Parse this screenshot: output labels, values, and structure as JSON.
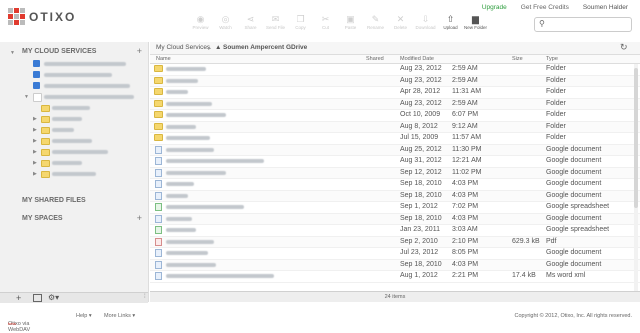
{
  "app": {
    "logo_text": "OTIXO"
  },
  "toolbar": [
    {
      "label": "Preview",
      "icon": "eye-icon",
      "enabled": false
    },
    {
      "label": "Watch",
      "icon": "watch-icon",
      "enabled": false
    },
    {
      "label": "Share",
      "icon": "share-icon",
      "enabled": false
    },
    {
      "label": "Send File",
      "icon": "send-icon",
      "enabled": false
    },
    {
      "label": "Copy",
      "icon": "copy-icon",
      "enabled": false
    },
    {
      "label": "Cut",
      "icon": "cut-icon",
      "enabled": false
    },
    {
      "label": "Paste",
      "icon": "paste-icon",
      "enabled": false
    },
    {
      "label": "Rename",
      "icon": "pencil-icon",
      "enabled": false
    },
    {
      "label": "Delete",
      "icon": "delete-icon",
      "enabled": false
    },
    {
      "label": "Download",
      "icon": "download-icon",
      "enabled": false
    },
    {
      "label": "Upload",
      "icon": "upload-icon",
      "enabled": true
    },
    {
      "label": "New Folder",
      "icon": "new-folder-icon",
      "enabled": true
    }
  ],
  "top_links": {
    "upgrade": "Upgrade",
    "credits": "Get Free Credits",
    "user": "Soumen Halder"
  },
  "search": {
    "placeholder": ""
  },
  "sidebar": {
    "cloud_title": "MY CLOUD SERVICES",
    "shared_title": "MY SHARED FILES",
    "spaces_title": "MY SPACES"
  },
  "breadcrumb": {
    "root": "My Cloud Services",
    "current": "Soumen Ampercent GDrive"
  },
  "columns": {
    "name": "Name",
    "shared": "Shared",
    "modified": "Modified Date",
    "size": "Size",
    "type": "Type"
  },
  "files": [
    {
      "kind": "folder",
      "date": "Aug 23, 2012",
      "time": "2:59 AM",
      "size": "",
      "type": "Folder"
    },
    {
      "kind": "folder",
      "date": "Aug 23, 2012",
      "time": "2:59 AM",
      "size": "",
      "type": "Folder"
    },
    {
      "kind": "folder",
      "date": "Apr 28, 2012",
      "time": "11:31 AM",
      "size": "",
      "type": "Folder"
    },
    {
      "kind": "folder",
      "date": "Aug 23, 2012",
      "time": "2:59 AM",
      "size": "",
      "type": "Folder"
    },
    {
      "kind": "folder",
      "date": "Oct 10, 2009",
      "time": "6:07 PM",
      "size": "",
      "type": "Folder"
    },
    {
      "kind": "folder",
      "date": "Aug 8, 2012",
      "time": "9:12 AM",
      "size": "",
      "type": "Folder"
    },
    {
      "kind": "folder",
      "date": "Jul 15, 2009",
      "time": "11:57 AM",
      "size": "",
      "type": "Folder"
    },
    {
      "kind": "doc",
      "date": "Aug 25, 2012",
      "time": "11:30 PM",
      "size": "",
      "type": "Google document"
    },
    {
      "kind": "doc",
      "date": "Aug 31, 2012",
      "time": "12:21 AM",
      "size": "",
      "type": "Google document"
    },
    {
      "kind": "doc",
      "date": "Sep 12, 2012",
      "time": "11:02 PM",
      "size": "",
      "type": "Google document"
    },
    {
      "kind": "doc",
      "date": "Sep 18, 2010",
      "time": "4:03 PM",
      "size": "",
      "type": "Google document"
    },
    {
      "kind": "doc",
      "date": "Sep 18, 2010",
      "time": "4:03 PM",
      "size": "",
      "type": "Google document"
    },
    {
      "kind": "xls",
      "date": "Sep 1, 2012",
      "time": "7:02 PM",
      "size": "",
      "type": "Google spreadsheet"
    },
    {
      "kind": "doc",
      "date": "Sep 18, 2010",
      "time": "4:03 PM",
      "size": "",
      "type": "Google document"
    },
    {
      "kind": "xls",
      "date": "Jan 23, 2011",
      "time": "3:03 AM",
      "size": "",
      "type": "Google spreadsheet"
    },
    {
      "kind": "pdf",
      "date": "Sep 2, 2010",
      "time": "2:10 PM",
      "size": "629.3 kB",
      "type": "Pdf"
    },
    {
      "kind": "doc",
      "date": "Jul 23, 2012",
      "time": "8:05 PM",
      "size": "",
      "type": "Google document"
    },
    {
      "kind": "doc",
      "date": "Sep 18, 2010",
      "time": "4:03 PM",
      "size": "",
      "type": "Google document"
    },
    {
      "kind": "doc",
      "date": "Aug 1, 2012",
      "time": "2:21 PM",
      "size": "17.4 kB",
      "type": "Ms word xml"
    }
  ],
  "status": {
    "count": "24 items"
  },
  "footer": {
    "webdav": "Otixo via WebDAV",
    "beta": "beta",
    "help": "Help ▾",
    "more": "More Links ▾",
    "copyright": "Copyright © 2012, Otixo, Inc. All rights reserved."
  }
}
